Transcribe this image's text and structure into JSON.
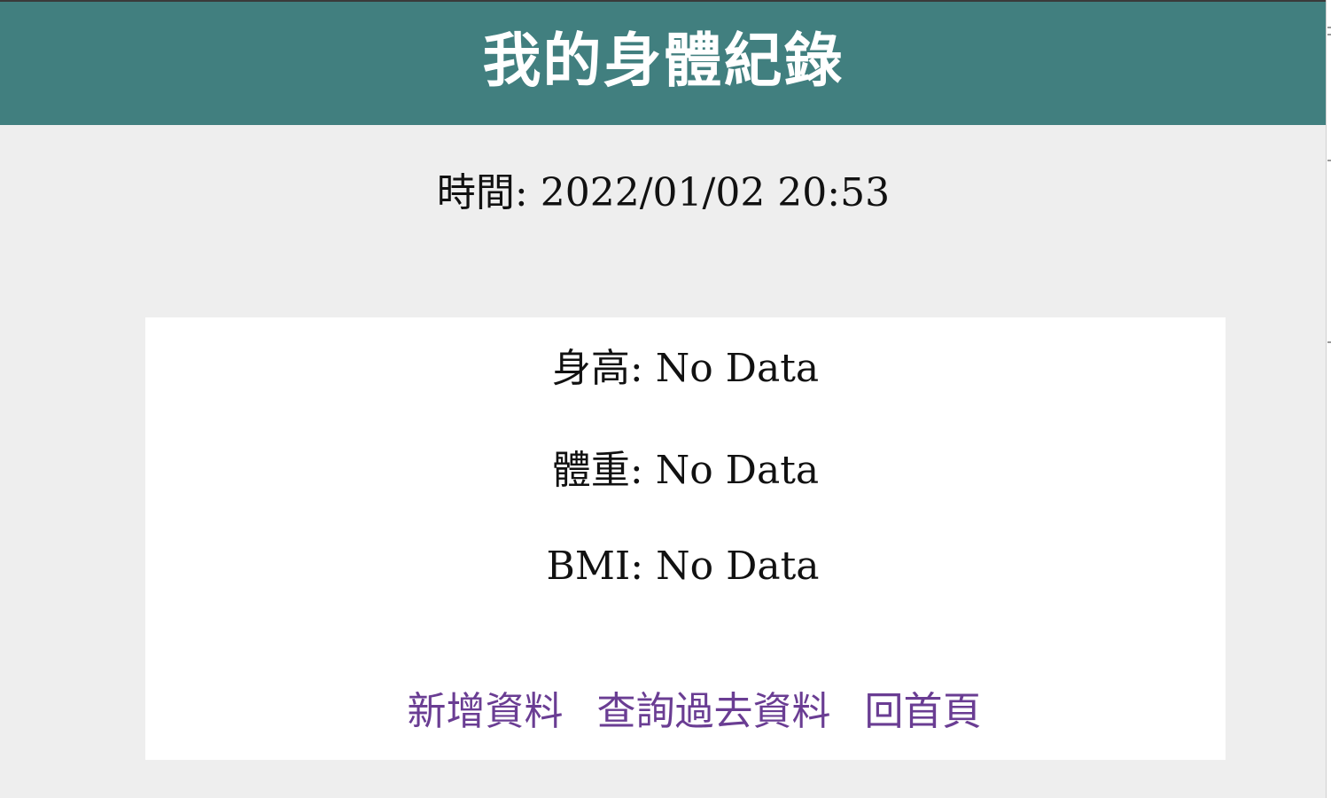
{
  "header": {
    "title": "我的身體紀錄"
  },
  "time": {
    "label": "時間:",
    "value": "2022/01/02 20:53"
  },
  "metrics": {
    "height": {
      "label": "身高:",
      "value": "No Data"
    },
    "weight": {
      "label": "體重:",
      "value": "No Data"
    },
    "bmi": {
      "label": "BMI:",
      "value": "No Data"
    }
  },
  "nav": {
    "add_data": "新增資料",
    "query_history": "查詢過去資料",
    "home": "回首頁"
  },
  "colors": {
    "header_bg": "#417f7f",
    "page_bg": "#eeeeee",
    "card_bg": "#ffffff",
    "link": "#6a3d93"
  }
}
